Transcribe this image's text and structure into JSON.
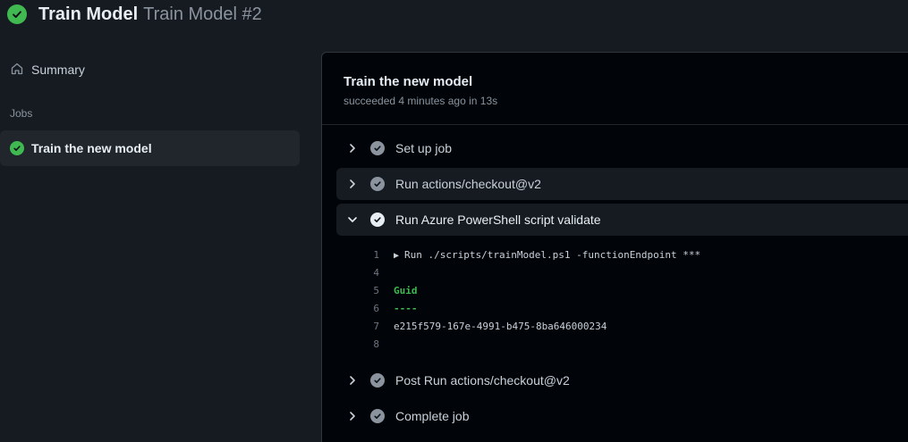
{
  "header": {
    "title": "Train Model",
    "run_label": "Train Model #2"
  },
  "sidebar": {
    "summary_label": "Summary",
    "jobs_heading": "Jobs",
    "jobs": [
      {
        "label": "Train the new model",
        "status": "success"
      }
    ]
  },
  "job": {
    "title": "Train the new model",
    "meta": "succeeded 4 minutes ago in 13s"
  },
  "steps": [
    {
      "label": "Set up job",
      "expanded": false
    },
    {
      "label": "Run actions/checkout@v2",
      "expanded": false
    },
    {
      "label": "Run Azure PowerShell script validate",
      "expanded": true
    },
    {
      "label": "Post Run actions/checkout@v2",
      "expanded": false
    },
    {
      "label": "Complete job",
      "expanded": false
    }
  ],
  "log": [
    {
      "num": "1",
      "text": "Run ./scripts/trainModel.ps1 -functionEndpoint ***"
    },
    {
      "num": "4",
      "text": ""
    },
    {
      "num": "5",
      "text": "Guid"
    },
    {
      "num": "6",
      "text": "----"
    },
    {
      "num": "7",
      "text": "e215f579-167e-4991-b475-8ba646000234"
    },
    {
      "num": "8",
      "text": ""
    }
  ],
  "colors": {
    "success": "#3fb950",
    "page_bg": "#161b22",
    "panel_bg": "#010409",
    "muted": "#8b949e"
  }
}
